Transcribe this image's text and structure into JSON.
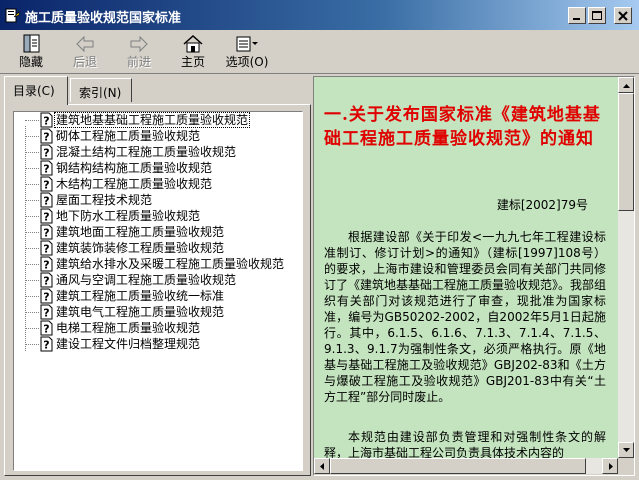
{
  "window": {
    "title": "施工质量验收规范国家标准",
    "controls": [
      "minimize",
      "maximize",
      "close"
    ]
  },
  "toolbar": {
    "items": [
      {
        "label": "隐藏",
        "icon": "hide-pane-icon",
        "enabled": true
      },
      {
        "label": "后退",
        "icon": "back-arrow-icon",
        "enabled": false
      },
      {
        "label": "前进",
        "icon": "forward-arrow-icon",
        "enabled": false
      },
      {
        "label": "主页",
        "icon": "home-icon",
        "enabled": true
      },
      {
        "label": "选项(O)",
        "icon": "options-icon",
        "enabled": true
      }
    ]
  },
  "tabs": [
    {
      "label": "目录(C)",
      "active": true
    },
    {
      "label": "索引(N)",
      "active": false
    }
  ],
  "tree": {
    "items": [
      "建筑地基基础工程施工质量验收规范",
      "砌体工程施工质量验收规范",
      "混凝土结构工程施工质量验收规范",
      "钢结构结构施工质量验收规范",
      "木结构工程施工质量验收规范",
      "屋面工程技术规范",
      "地下防水工程质量验收规范",
      "建筑地面工程施工质量验收规范",
      "建筑装饰装修工程质量验收规范",
      "建筑给水排水及采暖工程施工质量验收规范",
      "通风与空调工程施工质量验收规范",
      "建筑工程施工质量验收统一标准",
      "建筑电气工程施工质量验收规范",
      "电梯工程施工质量验收规范",
      "建设工程文件归档整理规范"
    ],
    "selected_index": 0
  },
  "document": {
    "title": "一.关于发布国家标准《建筑地基基础工程施工质量验收规范》的通知",
    "doc_number": "建标[2002]79号",
    "paragraph1": "根据建设部《关于印发<一九九七年工程建设标准制订、修订计划>的通知》（建标[1997]108号）的要求，上海市建设和管理委员会同有关部门共同修订了《建筑地基基础工程施工质量验收规范》。我部组织有关部门对该规范进行了审查，现批准为国家标准，编号为GB50202-2002，自2002年5月1日起施行。其中，6.1.5、6.1.6、7.1.3、7.1.4、7.1.5、9.1.3、9.1.7为强制性条文，必须严格执行。原《地基与基础工程施工及验收规范》GBJ202-83和《土方与爆破工程施工及验收规范》GBJ201-83中有关“土方工程”部分同时废止。",
    "paragraph2": "本规范由建设部负责管理和对强制性条文的解释，上海市基础工程公司负责具体技术内容的"
  },
  "colors": {
    "title_bar": "#0a246a",
    "content_background": "#c3e4be",
    "doc_title": "#e00000"
  }
}
